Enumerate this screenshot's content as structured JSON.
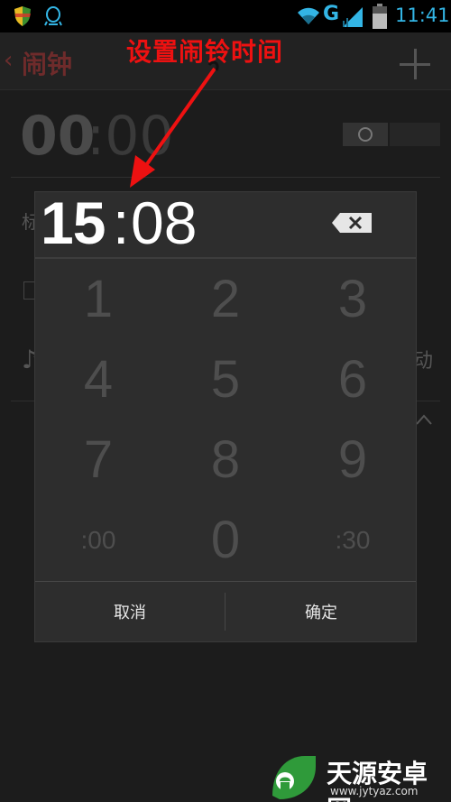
{
  "status_bar": {
    "network_type": "G",
    "time": "11:41",
    "accent_color": "#33b5e5"
  },
  "app_bar": {
    "back_glyph": "‹",
    "title": "闹钟"
  },
  "background": {
    "alarm_hour": "00",
    "alarm_minute": ":00",
    "partial_label": "标",
    "vibrate_partial": "动",
    "ringtone_icon": "♪"
  },
  "annotation": {
    "text": "设置闹铃时间",
    "color": "#ee1111"
  },
  "dialog": {
    "readout": {
      "hour": "15",
      "colon": ":",
      "minute": "08"
    },
    "keypad": [
      "1",
      "2",
      "3",
      "4",
      "5",
      "6",
      "7",
      "8",
      "9",
      ":00",
      "0",
      ":30"
    ],
    "cancel_label": "取消",
    "ok_label": "确定"
  },
  "watermark": {
    "name": "天源安卓网",
    "url": "www.jytyaz.com"
  }
}
